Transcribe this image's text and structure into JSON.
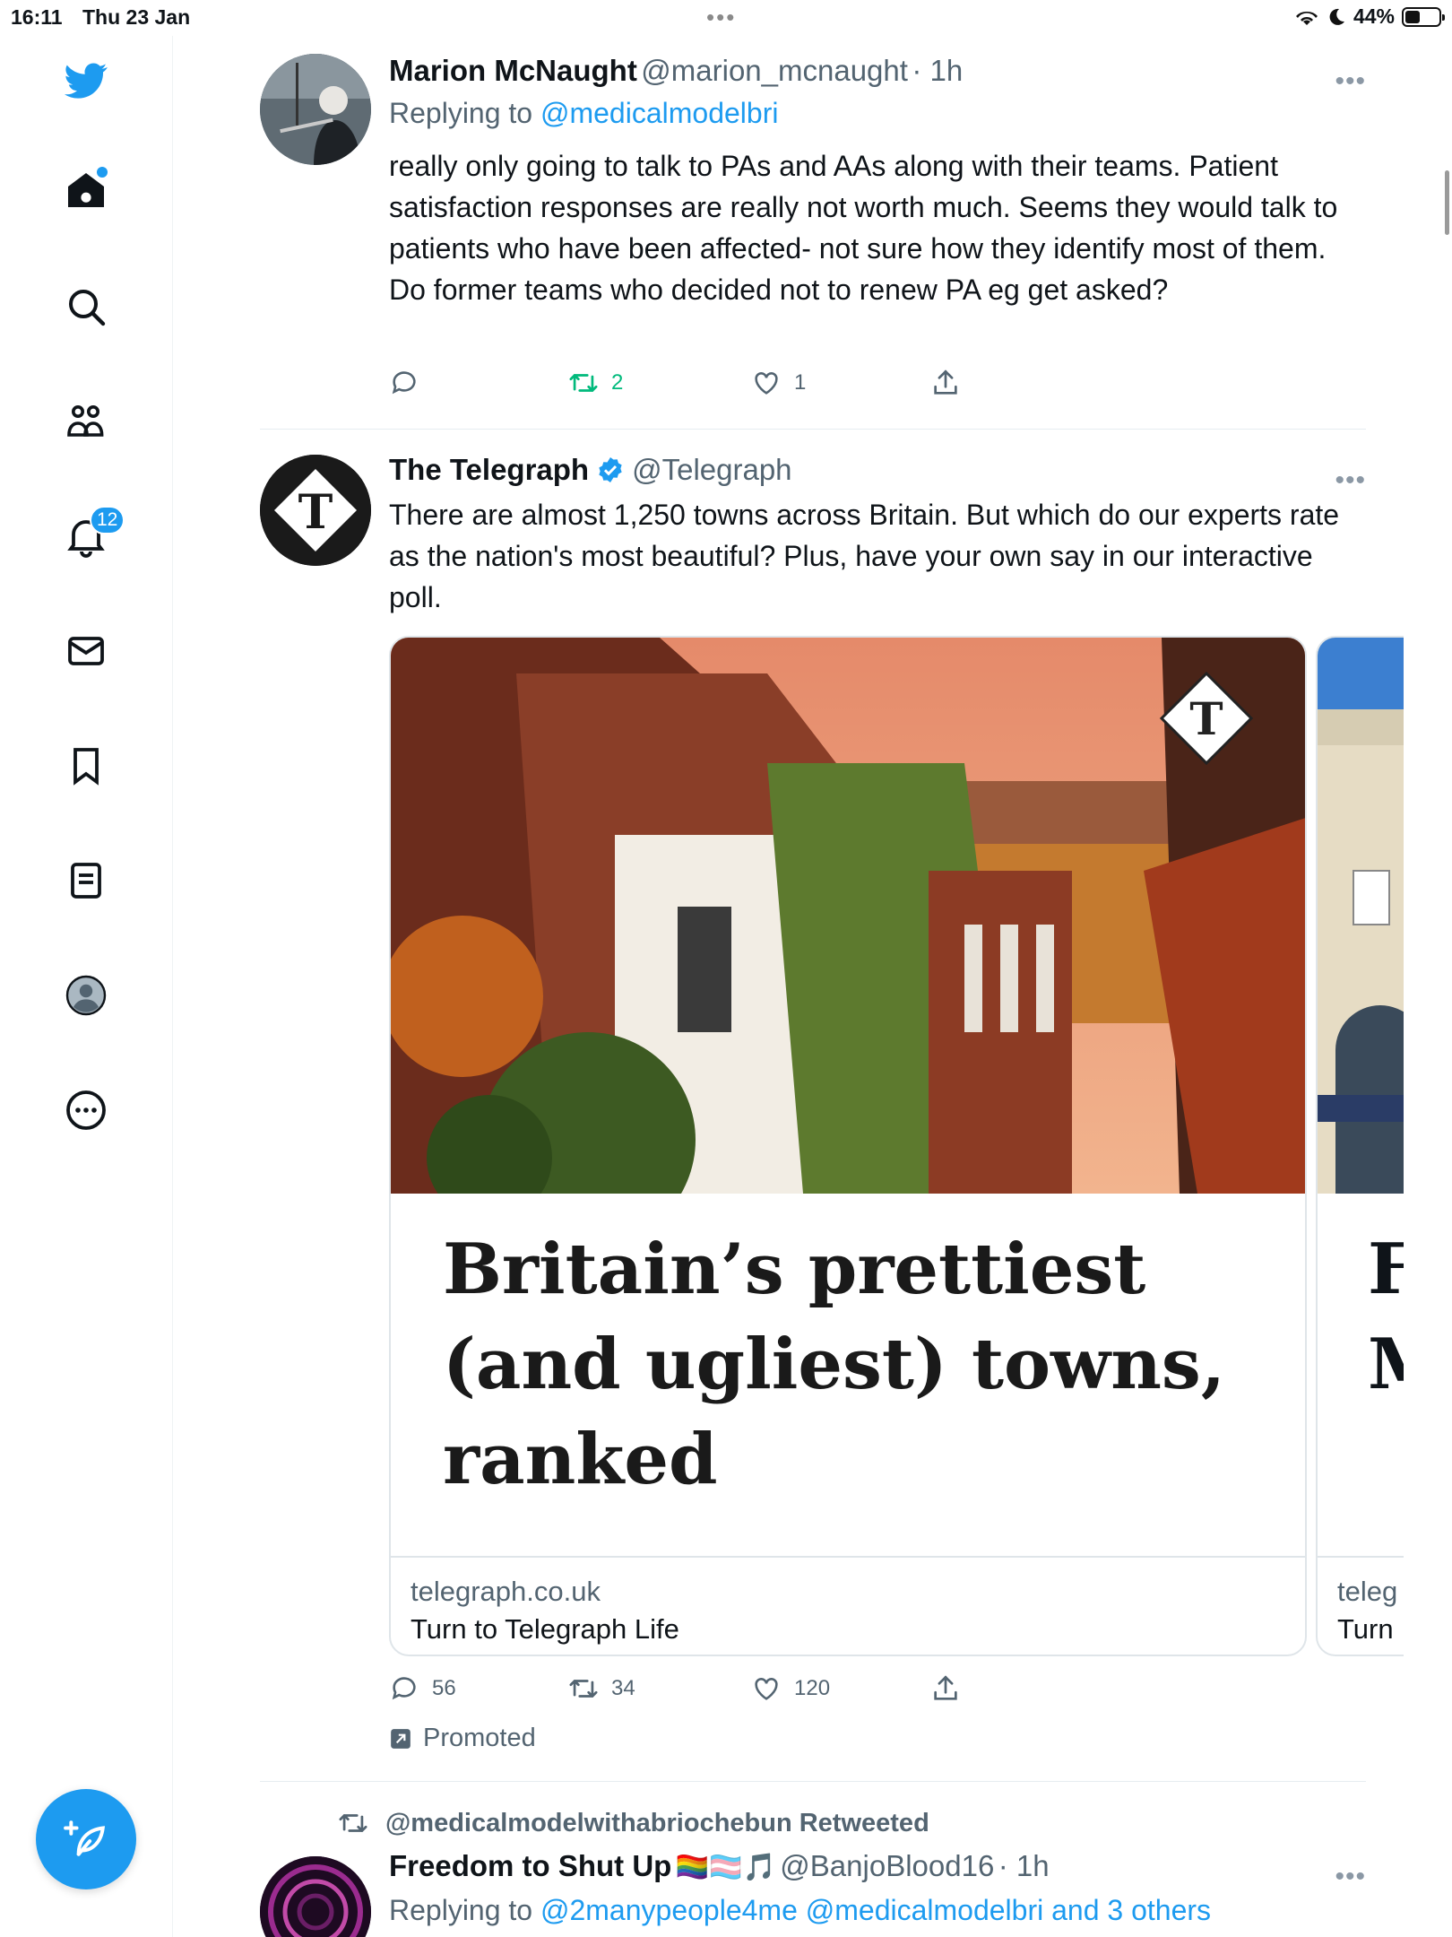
{
  "status_bar": {
    "time": "16:11",
    "date": "Thu 23 Jan",
    "battery": "44%",
    "battery_level": 0.44
  },
  "sidebar": {
    "notifications_badge": "12"
  },
  "tweets": [
    {
      "name": "Marion McNaught",
      "handle": "@marion_mcnaught",
      "time": "· 1h",
      "replying_prefix": "Replying to",
      "replying_to": "@medicalmodelbri",
      "text": "really only going to talk to PAs and AAs along with their teams. Patient satisfaction responses are really not worth much. Seems they would talk to patients who have been affected- not sure how they identify most of them. Do former teams who decided not to renew PA eg get asked?",
      "replies": "",
      "retweets": "2",
      "likes": "1"
    },
    {
      "name": "The Telegraph",
      "handle": "@Telegraph",
      "text": "There are almost 1,250 towns across Britain. But which do our experts rate as the nation's most beautiful? Plus, have your own say in our interactive poll.",
      "card": {
        "headline": "Britain’s prettiest (and ugliest) towns, ranked",
        "domain": "telegraph.co.uk",
        "subtitle": "Turn to Telegraph Life",
        "next_headline_partial": "F M",
        "next_domain_partial": "teleg",
        "next_subtitle_partial": "Turn"
      },
      "replies": "56",
      "retweets": "34",
      "likes": "120",
      "promoted": "Promoted"
    },
    {
      "retweeted_by": "@medicalmodelwithabriochebun Retweeted",
      "name": "Freedom to Shut Up",
      "name_emoji": "🏳️‍🌈🏳️‍⚧️🎵",
      "handle": "@BanjoBlood16",
      "time": "· 1h",
      "replying_prefix": "Replying to",
      "replying_to": "@2manypeople4me @medicalmodelbri and 3 others"
    }
  ],
  "colors": {
    "accent": "#1d9bf0",
    "retweet_green": "#00ba7c",
    "text_secondary": "#536471"
  }
}
